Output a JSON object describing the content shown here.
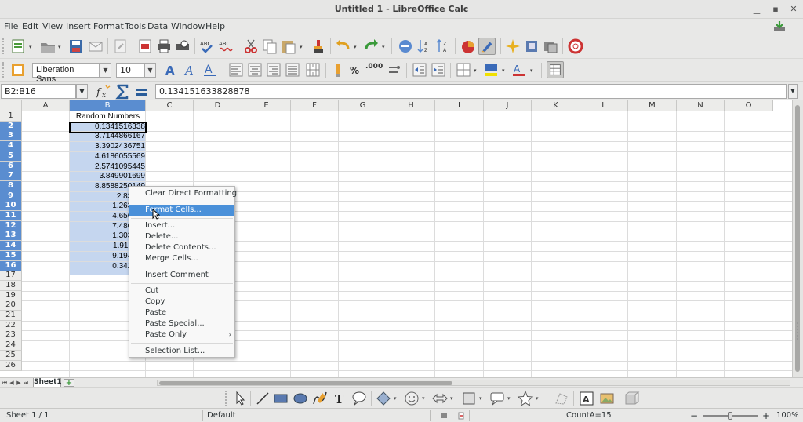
{
  "window": {
    "title": "Untitled 1 - LibreOffice Calc"
  },
  "menubar": {
    "items": [
      "File",
      "Edit",
      "View",
      "Insert",
      "Format",
      "Tools",
      "Data",
      "Window",
      "Help"
    ]
  },
  "formatting": {
    "font_name": "Liberation Sans",
    "font_size": "10",
    "percent_symbol": "%",
    "decimal_label": ".000"
  },
  "formula_bar": {
    "name_box": "B2:B16",
    "formula_value": "0.134151633828878"
  },
  "columns": [
    "A",
    "B",
    "C",
    "D",
    "E",
    "F",
    "G",
    "H",
    "I",
    "J",
    "K",
    "L",
    "M",
    "N",
    "O"
  ],
  "rows": [
    "1",
    "2",
    "3",
    "4",
    "5",
    "6",
    "7",
    "8",
    "9",
    "10",
    "11",
    "12",
    "13",
    "14",
    "15",
    "16",
    "17",
    "18",
    "19",
    "20",
    "21",
    "22",
    "23",
    "24",
    "25",
    "26"
  ],
  "cells": {
    "header": "Random Numbers",
    "b_values": [
      "0.1341516338",
      "3.7144866167",
      "3.3902436751",
      "4.6186055569",
      "2.5741095445",
      "3.849901699",
      "8.8588250149",
      "2.83721",
      "1.263796",
      "4.656085",
      "7.480839",
      "1.303787",
      "1.916110",
      "9.194887",
      "0.342334"
    ]
  },
  "context_menu": {
    "items": [
      {
        "label": "Clear Direct Formatting",
        "highlighted": false
      },
      {
        "label": "Format Cells...",
        "highlighted": true
      },
      {
        "label": "Insert...",
        "highlighted": false
      },
      {
        "label": "Delete...",
        "highlighted": false
      },
      {
        "label": "Delete Contents...",
        "highlighted": false
      },
      {
        "label": "Merge Cells...",
        "highlighted": false
      },
      {
        "label": "Insert Comment",
        "highlighted": false
      },
      {
        "label": "Cut",
        "highlighted": false
      },
      {
        "label": "Copy",
        "highlighted": false
      },
      {
        "label": "Paste",
        "highlighted": false
      },
      {
        "label": "Paste Special...",
        "highlighted": false
      },
      {
        "label": "Paste Only",
        "highlighted": false,
        "submenu": true
      },
      {
        "label": "Selection List...",
        "highlighted": false
      }
    ]
  },
  "sheet_tabs": {
    "active": "Sheet1",
    "add_symbol": "+"
  },
  "statusbar": {
    "sheet_info": "Sheet 1 / 1",
    "page_style": "Default",
    "selection_stat": "CountA=15",
    "zoom_minus": "−",
    "zoom_plus": "+",
    "zoom_level": "100%"
  },
  "colors": {
    "selection_header": "#5a8dd0",
    "selection_fill": "#c5d6ef",
    "menu_highlight": "#4a90d9"
  }
}
